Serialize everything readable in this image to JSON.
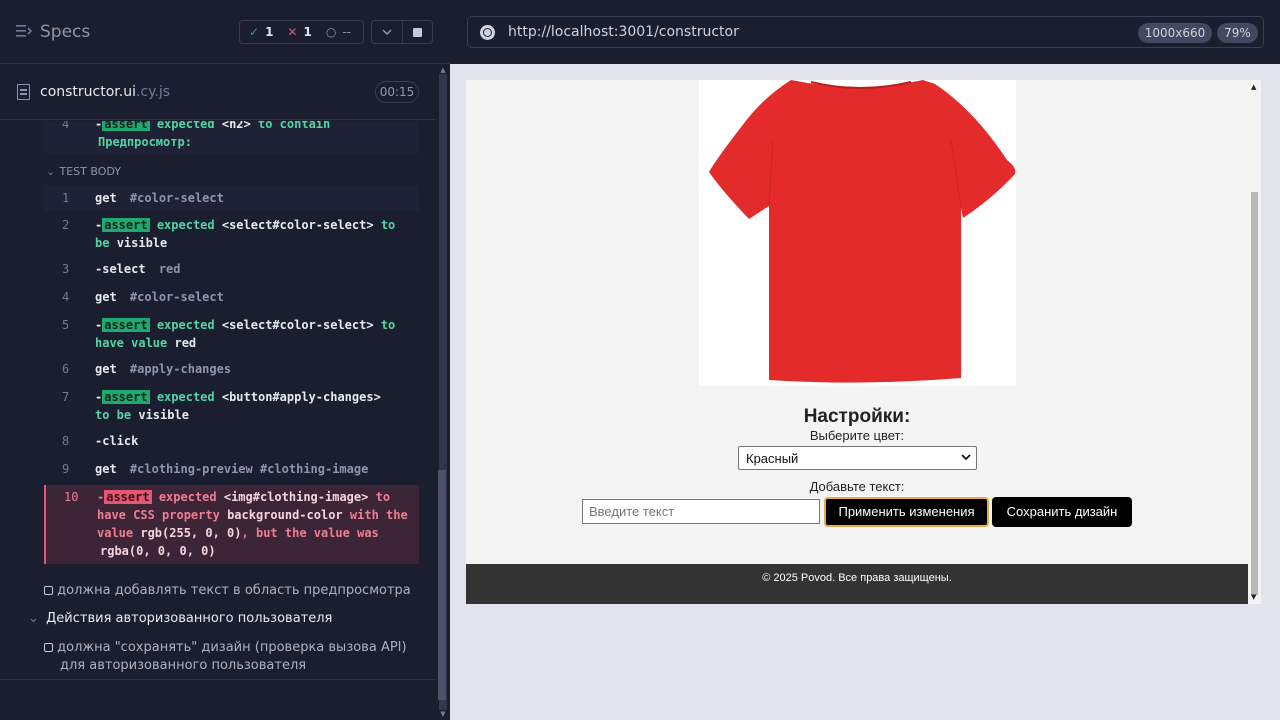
{
  "runner": {
    "title": "Specs",
    "stats": {
      "passed": "1",
      "failed": "1",
      "pending": "--"
    },
    "file": {
      "name": "constructor.ui",
      "ext": ".cy.js",
      "duration": "00:15"
    },
    "prev_command": {
      "num": "4",
      "dash": "-",
      "assert": "assert",
      "expected": "expected",
      "subject": "<h2>",
      "to": "to contain",
      "value": "Предпросмотр:"
    },
    "section_label": "TEST BODY",
    "commands": [
      {
        "num": "1",
        "name": "get",
        "sel": "#color-select"
      },
      {
        "num": "2",
        "dash": "-",
        "assert": "assert",
        "expected": "expected",
        "subject": "<select#color-select>",
        "to": "to",
        "to2": "be",
        "value": "visible"
      },
      {
        "num": "3",
        "name": "-select",
        "sel": "red"
      },
      {
        "num": "4",
        "name": "get",
        "sel": "#color-select"
      },
      {
        "num": "5",
        "dash": "-",
        "assert": "assert",
        "expected": "expected",
        "subject": "<select#color-select>",
        "to": "to",
        "to2": "have value",
        "value": "red"
      },
      {
        "num": "6",
        "name": "get",
        "sel": "#apply-changes"
      },
      {
        "num": "7",
        "dash": "-",
        "assert": "assert",
        "expected": "expected",
        "subject": "<button#apply-changes>",
        "to2": "to be",
        "value": "visible"
      },
      {
        "num": "8",
        "name": "-click",
        "sel": ""
      },
      {
        "num": "9",
        "name": "get",
        "sel": "#clothing-preview #clothing-image"
      },
      {
        "num": "10",
        "dash": "-",
        "assert": "assert",
        "expected": "expected",
        "subject": "<img#clothing-image>",
        "to": "to",
        "to2": "have CSS property",
        "prop": "background-color",
        "with": "with the",
        "with2": "value",
        "value": "rgb(255, 0, 0)",
        "but": ", but the value was",
        "actual": "rgba(0, 0, 0, 0)"
      }
    ],
    "tests": [
      {
        "label": "должна добавлять текст в область предпросмотра"
      }
    ],
    "suite": "Действия авторизованного пользователя",
    "suite_tests": [
      {
        "label_line1": "должна \"сохранять\" дизайн (проверка вызова API)",
        "label_line2": "для авторизованного пользователя"
      }
    ]
  },
  "browser": {
    "url": "http://localhost:3001/constructor",
    "viewport": "1000x660",
    "zoom": "79%"
  },
  "app": {
    "settings_heading": "Настройки:",
    "color_label": "Выберите цвет:",
    "color_selected": "Красный",
    "text_label": "Добавьте текст:",
    "text_placeholder": "Введите текст",
    "apply_button": "Применить изменения",
    "save_button": "Сохранить дизайн",
    "footer": "© 2025 Povod. Все права защищены.",
    "shirt_color": "#e32b2b"
  }
}
